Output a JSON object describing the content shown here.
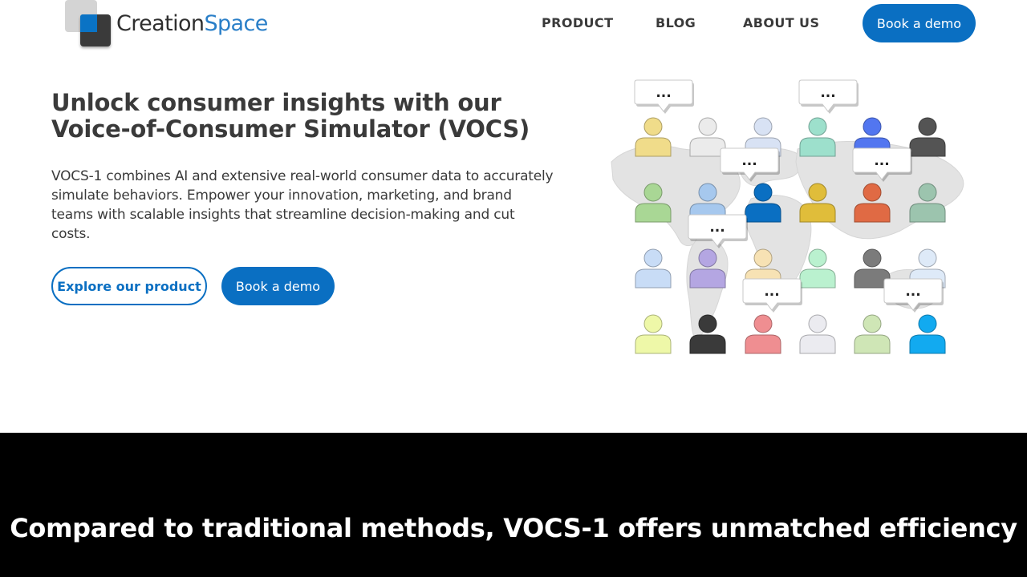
{
  "logo": {
    "part1": "Creation",
    "part2": "Space"
  },
  "nav": {
    "items": [
      {
        "label": "PRODUCT"
      },
      {
        "label": "BLOG"
      },
      {
        "label": "ABOUT US"
      }
    ],
    "cta": "Book a demo"
  },
  "hero": {
    "title": "Unlock consumer insights with our Voice-of-Consumer Simulator (VOCS)",
    "description": "VOCS-1 combines AI and extensive real-world consumer data to accurately simulate behaviors. Empower your innovation, marketing, and brand teams with scalable insights that streamline decision-making and cut costs.",
    "primary_button": "Explore our product",
    "secondary_button": "Book a demo"
  },
  "illustration": {
    "bubble_text": "...",
    "person_colors": [
      "#f0dc8a",
      "#ebebeb",
      "#d8e2f4",
      "#9de0cc",
      "#5276f0",
      "#545454",
      "#a9d795",
      "#a6c8ee",
      "#0a6fc2",
      "#e0bd3a",
      "#e06a44",
      "#9cc4ae",
      "#c8dcf6",
      "#b4a6e2",
      "#f7e2b4",
      "#baf1cf",
      "#7b7b7b",
      "#deeaf8",
      "#eef8a8",
      "#3a3a3a",
      "#ef8e91",
      "#ebebf0",
      "#cfe6b6",
      "#12aaf0"
    ]
  },
  "comparison": {
    "title": "Compared to traditional methods, VOCS-1 offers unmatched efficiency"
  }
}
